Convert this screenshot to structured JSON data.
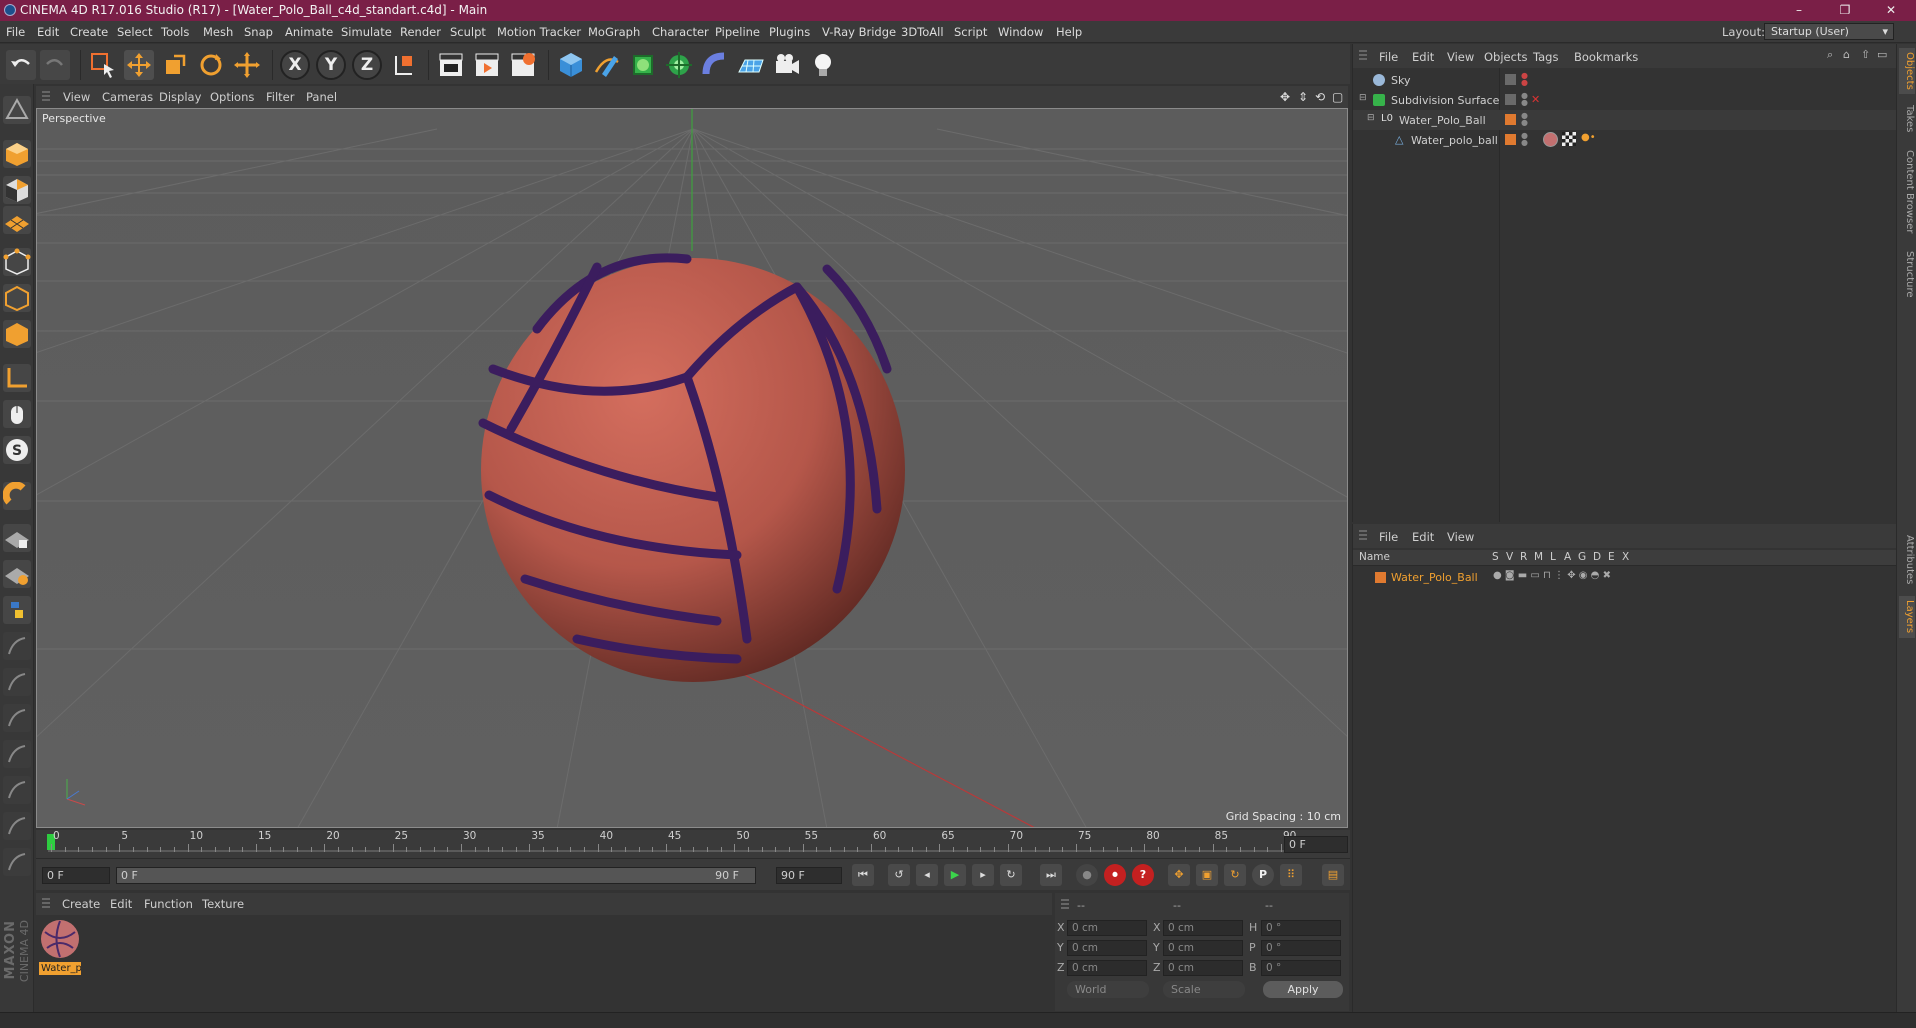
{
  "window": {
    "title": "CINEMA 4D R17.016 Studio (R17) - [Water_Polo_Ball_c4d_standart.c4d] - Main",
    "minimize": "–",
    "maximize": "❐",
    "close": "✕"
  },
  "menubar": {
    "items": [
      "File",
      "Edit",
      "Create",
      "Select",
      "Tools",
      "Mesh",
      "Snap",
      "Animate",
      "Simulate",
      "Render",
      "Sculpt",
      "Motion Tracker",
      "MoGraph",
      "Character",
      "Pipeline",
      "Plugins",
      "V-Ray Bridge",
      "3DToAll",
      "Script",
      "Window",
      "Help"
    ],
    "layout_label": "Layout:",
    "layout_value": "Startup (User)"
  },
  "toolbar": {
    "axis_x": "X",
    "axis_y": "Y",
    "axis_z": "Z"
  },
  "viewport": {
    "menu": [
      "View",
      "Cameras",
      "Display",
      "Options",
      "Filter",
      "Panel"
    ],
    "label": "Perspective",
    "grid_spacing": "Grid Spacing : 10 cm"
  },
  "timeline": {
    "ticks": [
      "0",
      "5",
      "10",
      "15",
      "20",
      "25",
      "30",
      "35",
      "40",
      "45",
      "50",
      "55",
      "60",
      "65",
      "70",
      "75",
      "80",
      "85",
      "90"
    ],
    "current_frame": "0 F",
    "start_field": "0 F",
    "range_start": "0 F",
    "range_end": "90 F",
    "end_field": "90 F"
  },
  "material_manager": {
    "menu": [
      "Create",
      "Edit",
      "Function",
      "Texture"
    ],
    "materials": [
      {
        "name": "Water_p"
      }
    ]
  },
  "coordinates": {
    "headers": [
      "--",
      "--",
      "--"
    ],
    "rows": [
      {
        "axis": "X",
        "pos": "0 cm",
        "axis2": "X",
        "size": "0 cm",
        "rot_label": "H",
        "rot": "0 °"
      },
      {
        "axis": "Y",
        "pos": "0 cm",
        "axis2": "Y",
        "size": "0 cm",
        "rot_label": "P",
        "rot": "0 °"
      },
      {
        "axis": "Z",
        "pos": "0 cm",
        "axis2": "Z",
        "size": "0 cm",
        "rot_label": "B",
        "rot": "0 °"
      }
    ],
    "mode_world": "World",
    "mode_scale": "Scale",
    "apply": "Apply"
  },
  "object_manager": {
    "menu": [
      "File",
      "Edit",
      "View",
      "Objects",
      "Tags",
      "Bookmarks"
    ],
    "objects": [
      {
        "name": "Sky"
      },
      {
        "name": "Subdivision Surface"
      },
      {
        "name": "Water_Polo_Ball"
      },
      {
        "name": "Water_polo_ball"
      }
    ]
  },
  "layer_manager": {
    "menu": [
      "File",
      "Edit",
      "View"
    ],
    "columns": [
      "Name",
      "S",
      "V",
      "R",
      "M",
      "L",
      "A",
      "G",
      "D",
      "E",
      "X"
    ],
    "layers": [
      {
        "name": "Water_Polo_Ball"
      }
    ]
  },
  "right_tabs": [
    "Objects",
    "Takes",
    "Content Browser",
    "Structure",
    "Attributes",
    "Layers"
  ],
  "branding": {
    "maxon": "MAXON",
    "product": "CINEMA 4D"
  },
  "colors": {
    "accent": "#f0a030",
    "title_bar": "#7a1f47",
    "ball": "#b5574a",
    "seam": "#3b1d5e"
  }
}
